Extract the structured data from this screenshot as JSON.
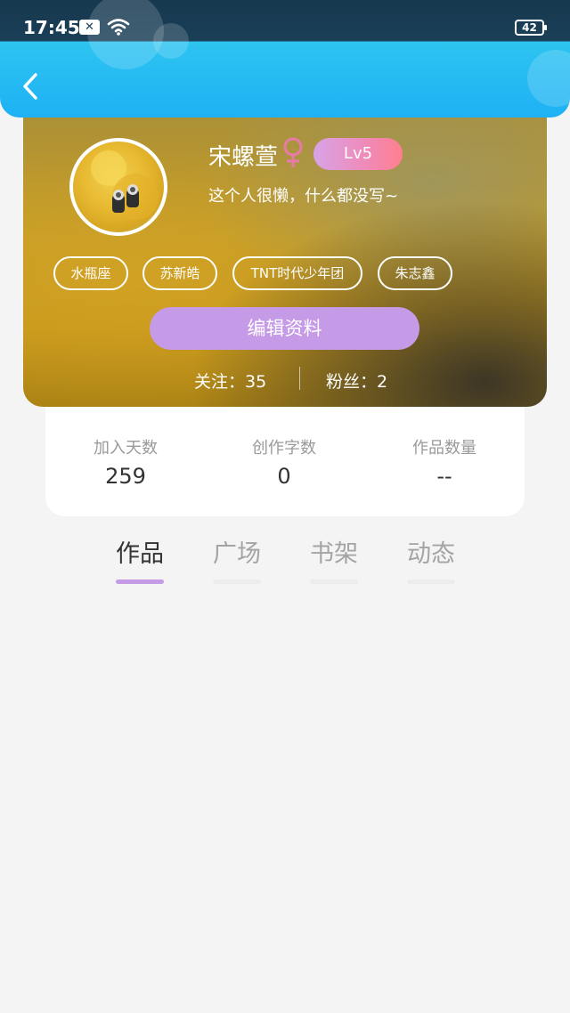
{
  "status_bar": {
    "time": "17:45",
    "notification_icon": "close-box-icon",
    "wifi_icon": "wifi-icon",
    "battery": "42"
  },
  "header": {
    "back_icon": "chevron-left-icon"
  },
  "profile": {
    "name": "宋螺萱",
    "gender_icon": "female-icon",
    "level": "Lv5",
    "bio": "这个人很懒，什么都没写~",
    "tags": [
      "水瓶座",
      "苏新皓",
      "TNT时代少年团",
      "朱志鑫"
    ],
    "edit_label": "编辑资料",
    "following": "关注：35",
    "fans": "粉丝：2"
  },
  "stats": [
    {
      "label": "加入天数",
      "value": "259"
    },
    {
      "label": "创作字数",
      "value": "0"
    },
    {
      "label": "作品数量",
      "value": "--"
    }
  ],
  "tabs": [
    {
      "label": "作品",
      "active": true
    },
    {
      "label": "广场",
      "active": false
    },
    {
      "label": "书架",
      "active": false
    },
    {
      "label": "动态",
      "active": false
    }
  ],
  "colors": {
    "accent": "#c59ae6",
    "header_blue": "#1eb1f5",
    "female": "#e87aa8"
  }
}
